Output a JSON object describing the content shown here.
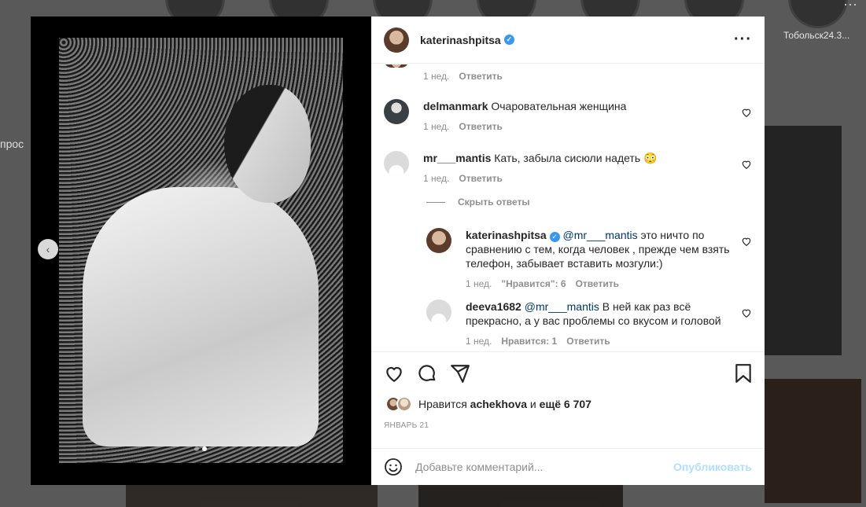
{
  "background": {
    "story_label": "Тобольск24.3...",
    "left_text": "прос"
  },
  "post": {
    "author": "katerinashpitsa",
    "more_icon": "more-horizontal-icon",
    "photo_count": 2,
    "photo_index": 2
  },
  "comments": [
    {
      "user": "",
      "text": "",
      "time": "1 нед.",
      "reply": "Ответить"
    },
    {
      "user": "delmanmark",
      "text": "Очаровательная женщина",
      "time": "1 нед.",
      "reply": "Ответить"
    },
    {
      "user": "mr___mantis",
      "text": "Кать, забыла сисюли надеть 😳",
      "time": "1 нед.",
      "reply": "Ответить"
    }
  ],
  "hide_replies": "Скрыть ответы",
  "replies": [
    {
      "user": "katerinashpitsa",
      "mention": "@mr___mantis",
      "text": " это ничто по сравнению с тем, когда человек , прежде чем взять телефон, забывает вставить мозгули:)",
      "time": "1 нед.",
      "likes": "\"Нравится\": 6",
      "reply": "Ответить"
    },
    {
      "user": "deeva1682",
      "mention": "@mr___mantis",
      "text": " В ней как раз всё прекрасно, а у вас проблемы со вкусом и головой",
      "time": "1 нед.",
      "likes": "Нравится: 1",
      "reply": "Ответить"
    }
  ],
  "likes_line": {
    "prefix": "Нравится ",
    "user": "achekhova",
    "middle": " и ",
    "count": "ещё 6 707"
  },
  "date": "ЯНВАРЬ 21",
  "composer": {
    "placeholder": "Добавьте комментарий...",
    "post_label": "Опубликовать"
  },
  "colors": {
    "accent": "#3897f0",
    "post_disabled": "#b2dffc",
    "meta": "#8e8e8e"
  }
}
